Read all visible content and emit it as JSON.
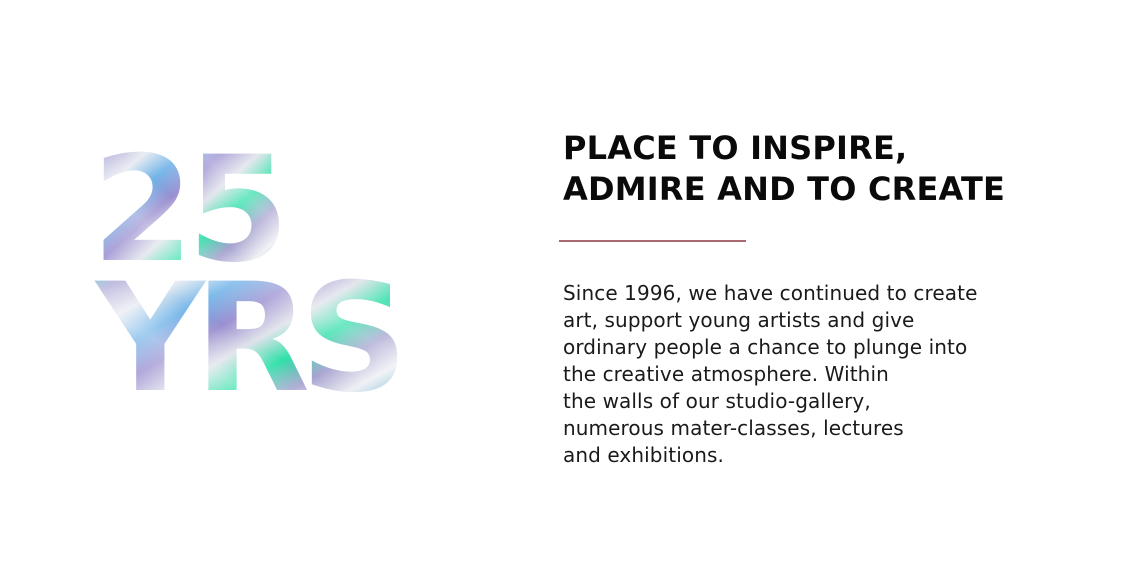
{
  "logo": {
    "number": "25",
    "unit": "YRS"
  },
  "headline": {
    "line1": "PLACE TO INSPIRE,",
    "line2": "ADMIRE AND TO CREATE"
  },
  "body": {
    "lines": [
      "Since 1996, we have continued to create",
      "art, support young artists and give",
      "ordinary people a chance to plunge into",
      "the creative atmosphere. Within",
      "the walls of our studio-gallery,",
      "numerous mater-classes, lectures",
      "and exhibitions."
    ]
  },
  "colors": {
    "accent_line": "#a86a70",
    "text": "#0a0a0a",
    "holo_teal": "#22d1c0",
    "holo_violet": "#8e84c8",
    "holo_silver": "#d9dbe3",
    "holo_green": "#2ee8a8"
  }
}
